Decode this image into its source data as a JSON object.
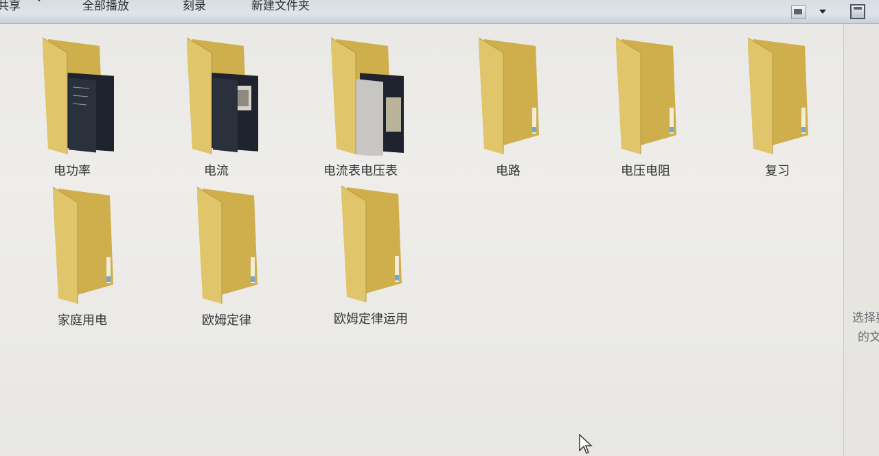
{
  "toolbar": {
    "share_label": "共享",
    "play_all_label": "全部播放",
    "burn_label": "刻录",
    "new_folder_label": "新建文件夹"
  },
  "folders": [
    {
      "name": "电功率",
      "icon": "folder-with-documents-icon"
    },
    {
      "name": "电流",
      "icon": "folder-with-documents-icon"
    },
    {
      "name": "电流表电压表",
      "icon": "folder-with-documents-icon"
    },
    {
      "name": "电路",
      "icon": "folder-empty-icon"
    },
    {
      "name": "电压电阻",
      "icon": "folder-empty-icon"
    },
    {
      "name": "复习",
      "icon": "folder-empty-icon"
    },
    {
      "name": "家庭用电",
      "icon": "folder-empty-icon"
    },
    {
      "name": "欧姆定律",
      "icon": "folder-empty-icon"
    },
    {
      "name": "欧姆定律运用",
      "icon": "folder-empty-icon"
    }
  ],
  "preview_pane": {
    "line1": "选择要",
    "line2": "的文"
  },
  "colors": {
    "folder_front": "#e0c56a",
    "folder_back": "#cfae4c",
    "toolbar_bg": "#dfe4e9",
    "content_bg": "#ecebe7"
  }
}
